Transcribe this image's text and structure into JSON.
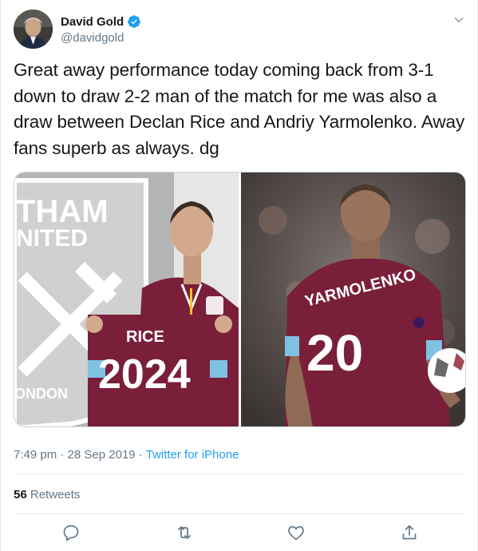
{
  "tweet": {
    "author_name": "David Gold",
    "author_handle": "@davidgold",
    "text": "Great away performance today coming back from 3-1 down to draw 2-2 man of the match for me was also a draw between Declan Rice and  Andriy Yarmolenko. Away fans superb as always. dg",
    "time": "7:49 pm",
    "date": "28 Sep 2019",
    "separator": "·",
    "source": "Twitter for iPhone",
    "retweet_count": "56",
    "retweet_label": "Retweets"
  },
  "photos": {
    "left": {
      "wall_line1": "THAM",
      "wall_line2": "NITED",
      "wall_line3": "ONDON",
      "shirt_name": "RICE",
      "shirt_number": "2024"
    },
    "right": {
      "shirt_name": "YARMOLENKO",
      "shirt_number": "20"
    }
  },
  "icons": {
    "verified": "verified-badge-icon",
    "caret": "chevron-down-icon",
    "reply": "reply-icon",
    "retweet": "retweet-icon",
    "like": "heart-icon",
    "share": "share-icon"
  },
  "colors": {
    "accent": "#1da1f2",
    "text": "#14171a",
    "secondary": "#657786",
    "divider": "#e6ecf0",
    "claret": "#7a1f3a",
    "sky_blue": "#7fc1e3"
  }
}
